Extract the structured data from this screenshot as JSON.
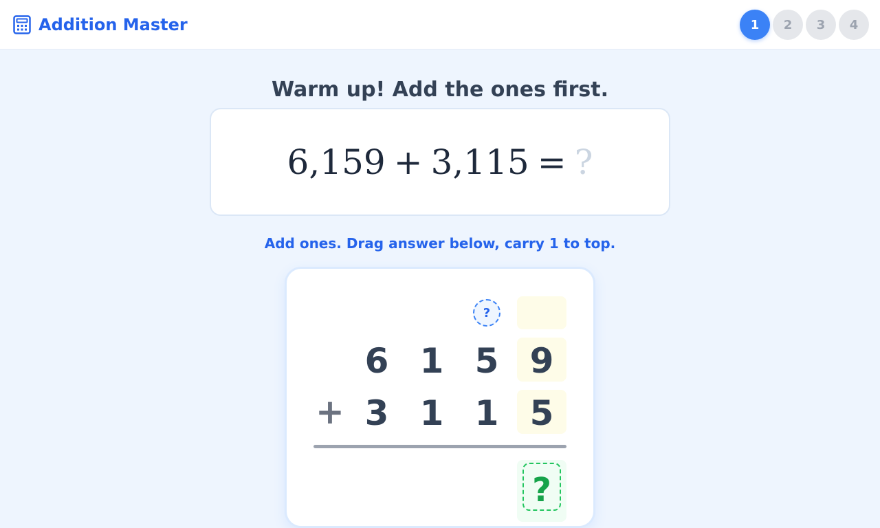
{
  "header": {
    "title": "Addition Master",
    "logo_icon": "calculator-icon",
    "steps": [
      {
        "label": "1",
        "active": true
      },
      {
        "label": "2",
        "active": false
      },
      {
        "label": "3",
        "active": false
      },
      {
        "label": "4",
        "active": false
      }
    ]
  },
  "prompt": "Warm up! Add the ones first.",
  "equation": {
    "addend1": "6,159",
    "operator": "+",
    "addend2": "3,115",
    "equals": "=",
    "result": "?"
  },
  "instruction": "Add ones. Drag answer below, carry 1 to top.",
  "worksheet": {
    "carry_placeholder": "?",
    "row1": [
      "6",
      "1",
      "5",
      "9"
    ],
    "plus": "+",
    "row2": [
      "3",
      "1",
      "1",
      "5"
    ],
    "answer_placeholder": "?"
  },
  "colors": {
    "accent": "#2563eb",
    "step_active": "#3b82f6",
    "highlight_column": "#fefce8",
    "answer_slot": "#22c55e"
  }
}
